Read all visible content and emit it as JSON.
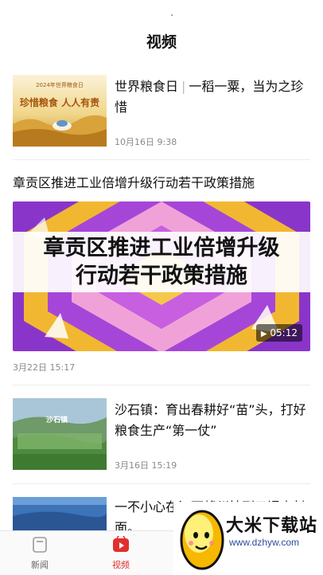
{
  "header": {
    "title": "视频"
  },
  "items": [
    {
      "title_part1": "世界粮食日",
      "title_separator": "|",
      "title_part2": "一稻一粟，当为之珍惜",
      "time": "10月16日 9:38",
      "thumb_caption_top": "2024年世界粮食日",
      "thumb_caption_main": "珍惜粮食 人人有责"
    },
    {
      "title": "章贡区推进工业倍增升级行动若干政策措施",
      "video_line1": "章贡区推进工业倍增升级",
      "video_line2": "行动若干政策措施",
      "duration": "05:12",
      "time": "3月22日 15:17"
    },
    {
      "title": "沙石镇：育出春耕好“苗”头，打好粮食生产“第一仗”",
      "time": "3月16日 15:19",
      "thumb_label": "沙石镇"
    },
    {
      "title": "一不小心在江西赣州拍到了课本封面。"
    }
  ],
  "tabbar": {
    "tabs": [
      {
        "label": "新闻",
        "icon": "news-icon"
      },
      {
        "label": "视频",
        "icon": "video-icon"
      },
      {
        "label": "",
        "icon": "camera-icon"
      }
    ]
  },
  "watermark": {
    "text": "大米下载站",
    "url": "www.dzhyw.com"
  },
  "colors": {
    "accent": "#e02f2f",
    "video_purple": "#8a35c9",
    "video_yellow": "#f2b731"
  }
}
